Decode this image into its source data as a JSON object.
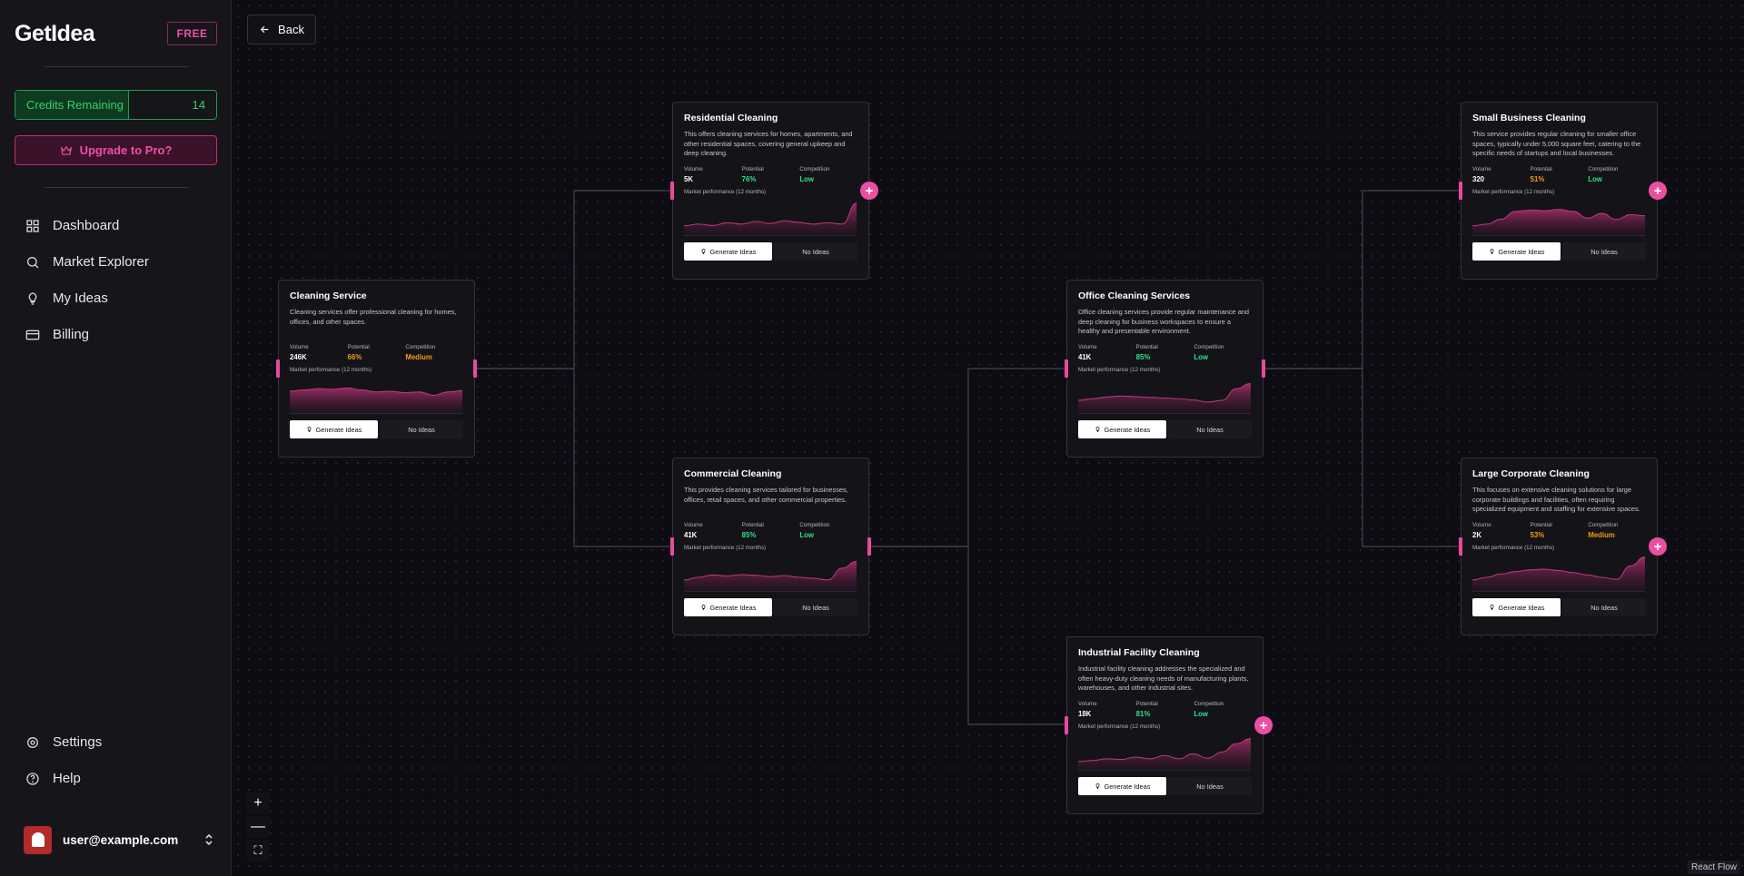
{
  "sidebar": {
    "logo": "GetIdea",
    "plan_badge": "FREE",
    "credits_label": "Credits Remaining",
    "credits_value": "14",
    "upgrade_label": "Upgrade to Pro?",
    "nav": [
      {
        "label": "Dashboard",
        "icon": "grid-icon"
      },
      {
        "label": "Market Explorer",
        "icon": "search-icon"
      },
      {
        "label": "My Ideas",
        "icon": "lightbulb-icon"
      },
      {
        "label": "Billing",
        "icon": "credit-card-icon"
      }
    ],
    "bottom_nav": [
      {
        "label": "Settings",
        "icon": "gear-icon"
      },
      {
        "label": "Help",
        "icon": "help-circle-icon"
      }
    ],
    "user_email": "user@example.com"
  },
  "canvas": {
    "back_label": "Back",
    "attribution": "React Flow",
    "zoom_controls": [
      "+",
      "—",
      "⛶"
    ]
  },
  "labels": {
    "volume": "Volume",
    "potential": "Potential",
    "competition": "Competition",
    "perf": "Market performance (12 months)",
    "generate": "Generate Ideas",
    "no_ideas": "No Ideas"
  },
  "colors": {
    "accent": "#ec4ea3",
    "green": "#2ee08a",
    "orange": "#f59a1b",
    "credits": "#34d068"
  },
  "nodes": [
    {
      "id": "cleaning",
      "title": "Cleaning Service",
      "desc": "Cleaning services offer professional cleaning for homes, offices, and other spaces.",
      "volume": "246K",
      "potential": "66%",
      "potential_level": "orange",
      "competition": "Medium",
      "competition_level": "orange",
      "series": [
        0.62,
        0.66,
        0.7,
        0.68,
        0.72,
        0.66,
        0.6,
        0.62,
        0.58,
        0.6,
        0.5,
        0.6,
        0.64
      ],
      "has_plus": false
    },
    {
      "id": "residential",
      "title": "Residential Cleaning",
      "desc": "This offers cleaning services for homes, apartments, and other residential spaces, covering general upkeep and deep cleaning.",
      "volume": "5K",
      "potential": "76%",
      "potential_level": "green",
      "competition": "Low",
      "competition_level": "green",
      "series": [
        0.25,
        0.3,
        0.26,
        0.34,
        0.3,
        0.38,
        0.32,
        0.4,
        0.35,
        0.3,
        0.34,
        0.3,
        0.92
      ],
      "has_plus": true
    },
    {
      "id": "commercial",
      "title": "Commercial Cleaning",
      "desc": "This provides cleaning services tailored for businesses, offices, retail spaces, and other commercial properties.",
      "volume": "41K",
      "potential": "85%",
      "potential_level": "green",
      "competition": "Low",
      "competition_level": "green",
      "series": [
        0.3,
        0.38,
        0.45,
        0.42,
        0.46,
        0.44,
        0.4,
        0.43,
        0.38,
        0.35,
        0.3,
        0.65,
        0.85
      ],
      "has_plus": false
    },
    {
      "id": "office",
      "title": "Office Cleaning Services",
      "desc": "Office cleaning services provide regular maintenance and deep cleaning for business workspaces to ensure a healthy and presentable environment.",
      "volume": "41K",
      "potential": "85%",
      "potential_level": "green",
      "competition": "Low",
      "competition_level": "green",
      "series": [
        0.35,
        0.4,
        0.45,
        0.48,
        0.46,
        0.44,
        0.42,
        0.4,
        0.36,
        0.3,
        0.35,
        0.7,
        0.85
      ],
      "has_plus": false
    },
    {
      "id": "industrial",
      "title": "Industrial Facility Cleaning",
      "desc": "Industrial facility cleaning addresses the specialized and often heavy-duty cleaning needs of manufacturing plants, warehouses, and other industrial sites.",
      "volume": "18K",
      "potential": "81%",
      "potential_level": "green",
      "competition": "Low",
      "competition_level": "green",
      "series": [
        0.22,
        0.25,
        0.3,
        0.28,
        0.35,
        0.3,
        0.4,
        0.3,
        0.45,
        0.32,
        0.5,
        0.75,
        0.9
      ],
      "has_plus": true
    },
    {
      "id": "small_business",
      "title": "Small Business Cleaning",
      "desc": "This service provides regular cleaning for smaller office spaces, typically under 5,000 square feet, catering to the specific needs of startups and local businesses.",
      "volume": "320",
      "potential": "51%",
      "potential_level": "orange",
      "competition": "Low",
      "competition_level": "green",
      "series": [
        0.25,
        0.3,
        0.45,
        0.68,
        0.72,
        0.7,
        0.74,
        0.68,
        0.48,
        0.62,
        0.44,
        0.58,
        0.55
      ],
      "has_plus": true
    },
    {
      "id": "large_corporate",
      "title": "Large Corporate Cleaning",
      "desc": "This focuses on extensive cleaning solutions for large corporate buildings and facilities, often requiring specialized equipment and staffing for extensive spaces.",
      "volume": "2K",
      "potential": "53%",
      "potential_level": "orange",
      "competition": "Medium",
      "competition_level": "orange",
      "series": [
        0.3,
        0.38,
        0.48,
        0.55,
        0.6,
        0.62,
        0.58,
        0.52,
        0.45,
        0.38,
        0.32,
        0.72,
        0.98
      ],
      "has_plus": true
    }
  ]
}
